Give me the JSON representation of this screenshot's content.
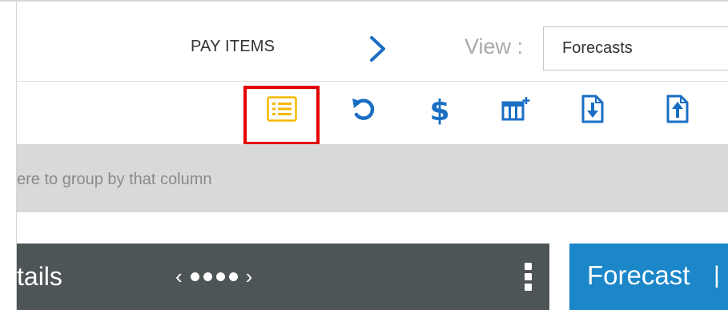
{
  "header": {
    "pay_items_label": "PAY ITEMS",
    "view_label": "View :",
    "view_select_value": "Forecasts"
  },
  "toolbar": {
    "tools": [
      {
        "icon": "list-view-icon",
        "color": "#f5b800",
        "highlighted": true
      },
      {
        "icon": "undo-icon",
        "color": "#1a6fc4"
      },
      {
        "icon": "dollar-icon",
        "color": "#1a6fc4",
        "glyph": "$"
      },
      {
        "icon": "add-column-icon",
        "color": "#1a6fc4"
      },
      {
        "icon": "import-icon",
        "color": "#1a6fc4"
      },
      {
        "icon": "export-icon",
        "color": "#1a6fc4"
      }
    ],
    "highlight_color": "#e40000"
  },
  "group_bar": {
    "text": "ere to group by that column"
  },
  "details_panel": {
    "title": "tails",
    "pager_prev": "‹",
    "pager_next": "›",
    "dot_count": 4
  },
  "forecast_panel": {
    "title": "Forecast",
    "separator": "|"
  },
  "colors": {
    "accent_blue": "#1a6fc4",
    "panel_dark": "#4e5556",
    "panel_blue": "#1b87c9",
    "group_bar_bg": "#d9d9d9"
  }
}
